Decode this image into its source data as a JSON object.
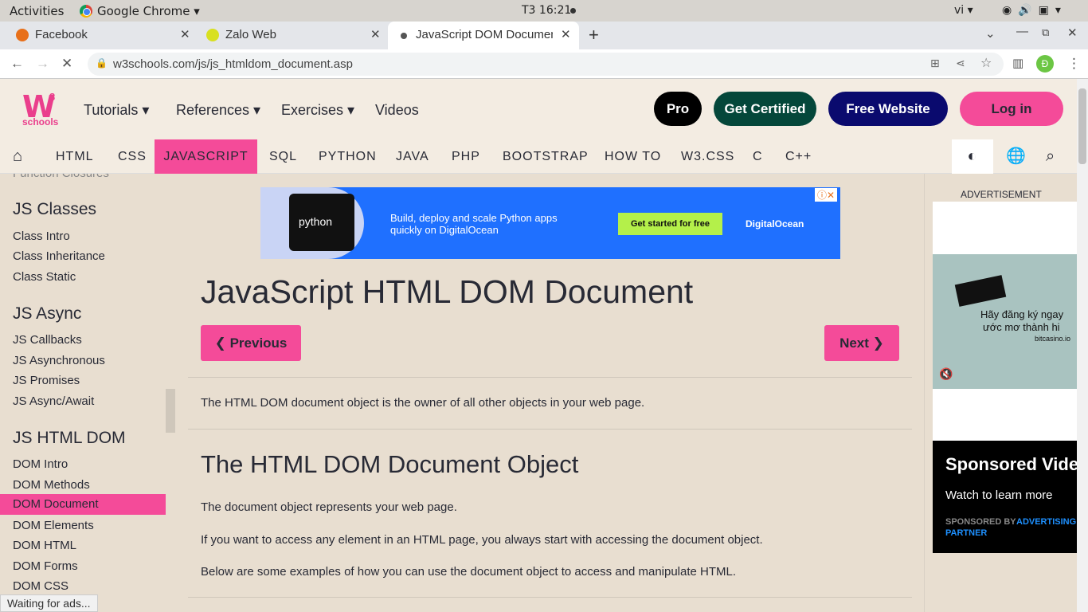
{
  "gnome": {
    "activities": "Activities",
    "app": "Google Chrome ▾",
    "clock": "T3 16:21",
    "lang": "vi ▾"
  },
  "browser": {
    "tabs": [
      {
        "title": "Facebook"
      },
      {
        "title": "Zalo Web"
      },
      {
        "title": "JavaScript DOM Documen"
      }
    ],
    "url": "w3schools.com/js/js_htmldom_document.asp",
    "avatar": "Đ"
  },
  "site": {
    "logo": {
      "w": "W",
      "sup": "3",
      "schools": "schools"
    },
    "menu": [
      "Tutorials ▾",
      "References ▾",
      "Exercises ▾",
      "Videos"
    ],
    "buttons": {
      "pro": "Pro",
      "certified": "Get Certified",
      "free": "Free Website",
      "login": "Log in"
    },
    "subnav": [
      "HTML",
      "CSS",
      "JAVASCRIPT",
      "SQL",
      "PYTHON",
      "JAVA",
      "PHP",
      "BOOTSTRAP",
      "HOW TO",
      "W3.CSS",
      "C",
      "C++"
    ]
  },
  "sidebar": {
    "cut": "Function Closures",
    "classes_head": "JS Classes",
    "classes": [
      "Class Intro",
      "Class Inheritance",
      "Class Static"
    ],
    "async_head": "JS Async",
    "async": [
      "JS Callbacks",
      "JS Asynchronous",
      "JS Promises",
      "JS Async/Await"
    ],
    "dom_head": "JS HTML DOM",
    "dom": [
      "DOM Intro",
      "DOM Methods",
      "DOM Document",
      "DOM Elements",
      "DOM HTML",
      "DOM Forms",
      "DOM CSS"
    ]
  },
  "ad": {
    "python": "python",
    "text1": "Build, deploy and scale Python apps",
    "text2": "quickly on DigitalOcean",
    "cta": "Get started for free",
    "brand": "DigitalOcean"
  },
  "main": {
    "title": "JavaScript HTML DOM Document",
    "prev": "❮ Previous",
    "next": "Next ❯",
    "intro": "The HTML DOM document object is the owner of all other objects in your web page.",
    "h2": "The HTML DOM Document Object",
    "p1": "The document object represents your web page.",
    "p2": "If you want to access any element in an HTML page, you always start with accessing the document object.",
    "p3": "Below are some examples of how you can use the document object to access and manipulate HTML."
  },
  "right": {
    "adlabel": "ADVERTISEMENT",
    "ad_line1": "Hãy đăng ký ngay",
    "ad_line2": "ước mơ thành hi",
    "ad_site": "bitcasino.io",
    "sponsored": "Sponsored Vide",
    "watch": "Watch to learn more",
    "by": "SPONSORED BY",
    "partner1": "ADVERTISING",
    "partner2": "PARTNER"
  },
  "status": "Waiting for ads...",
  "colors": {
    "pink": "#f44b99",
    "green": "#04473a",
    "navy": "#0a0a6e",
    "bg": "#e8ded0"
  }
}
